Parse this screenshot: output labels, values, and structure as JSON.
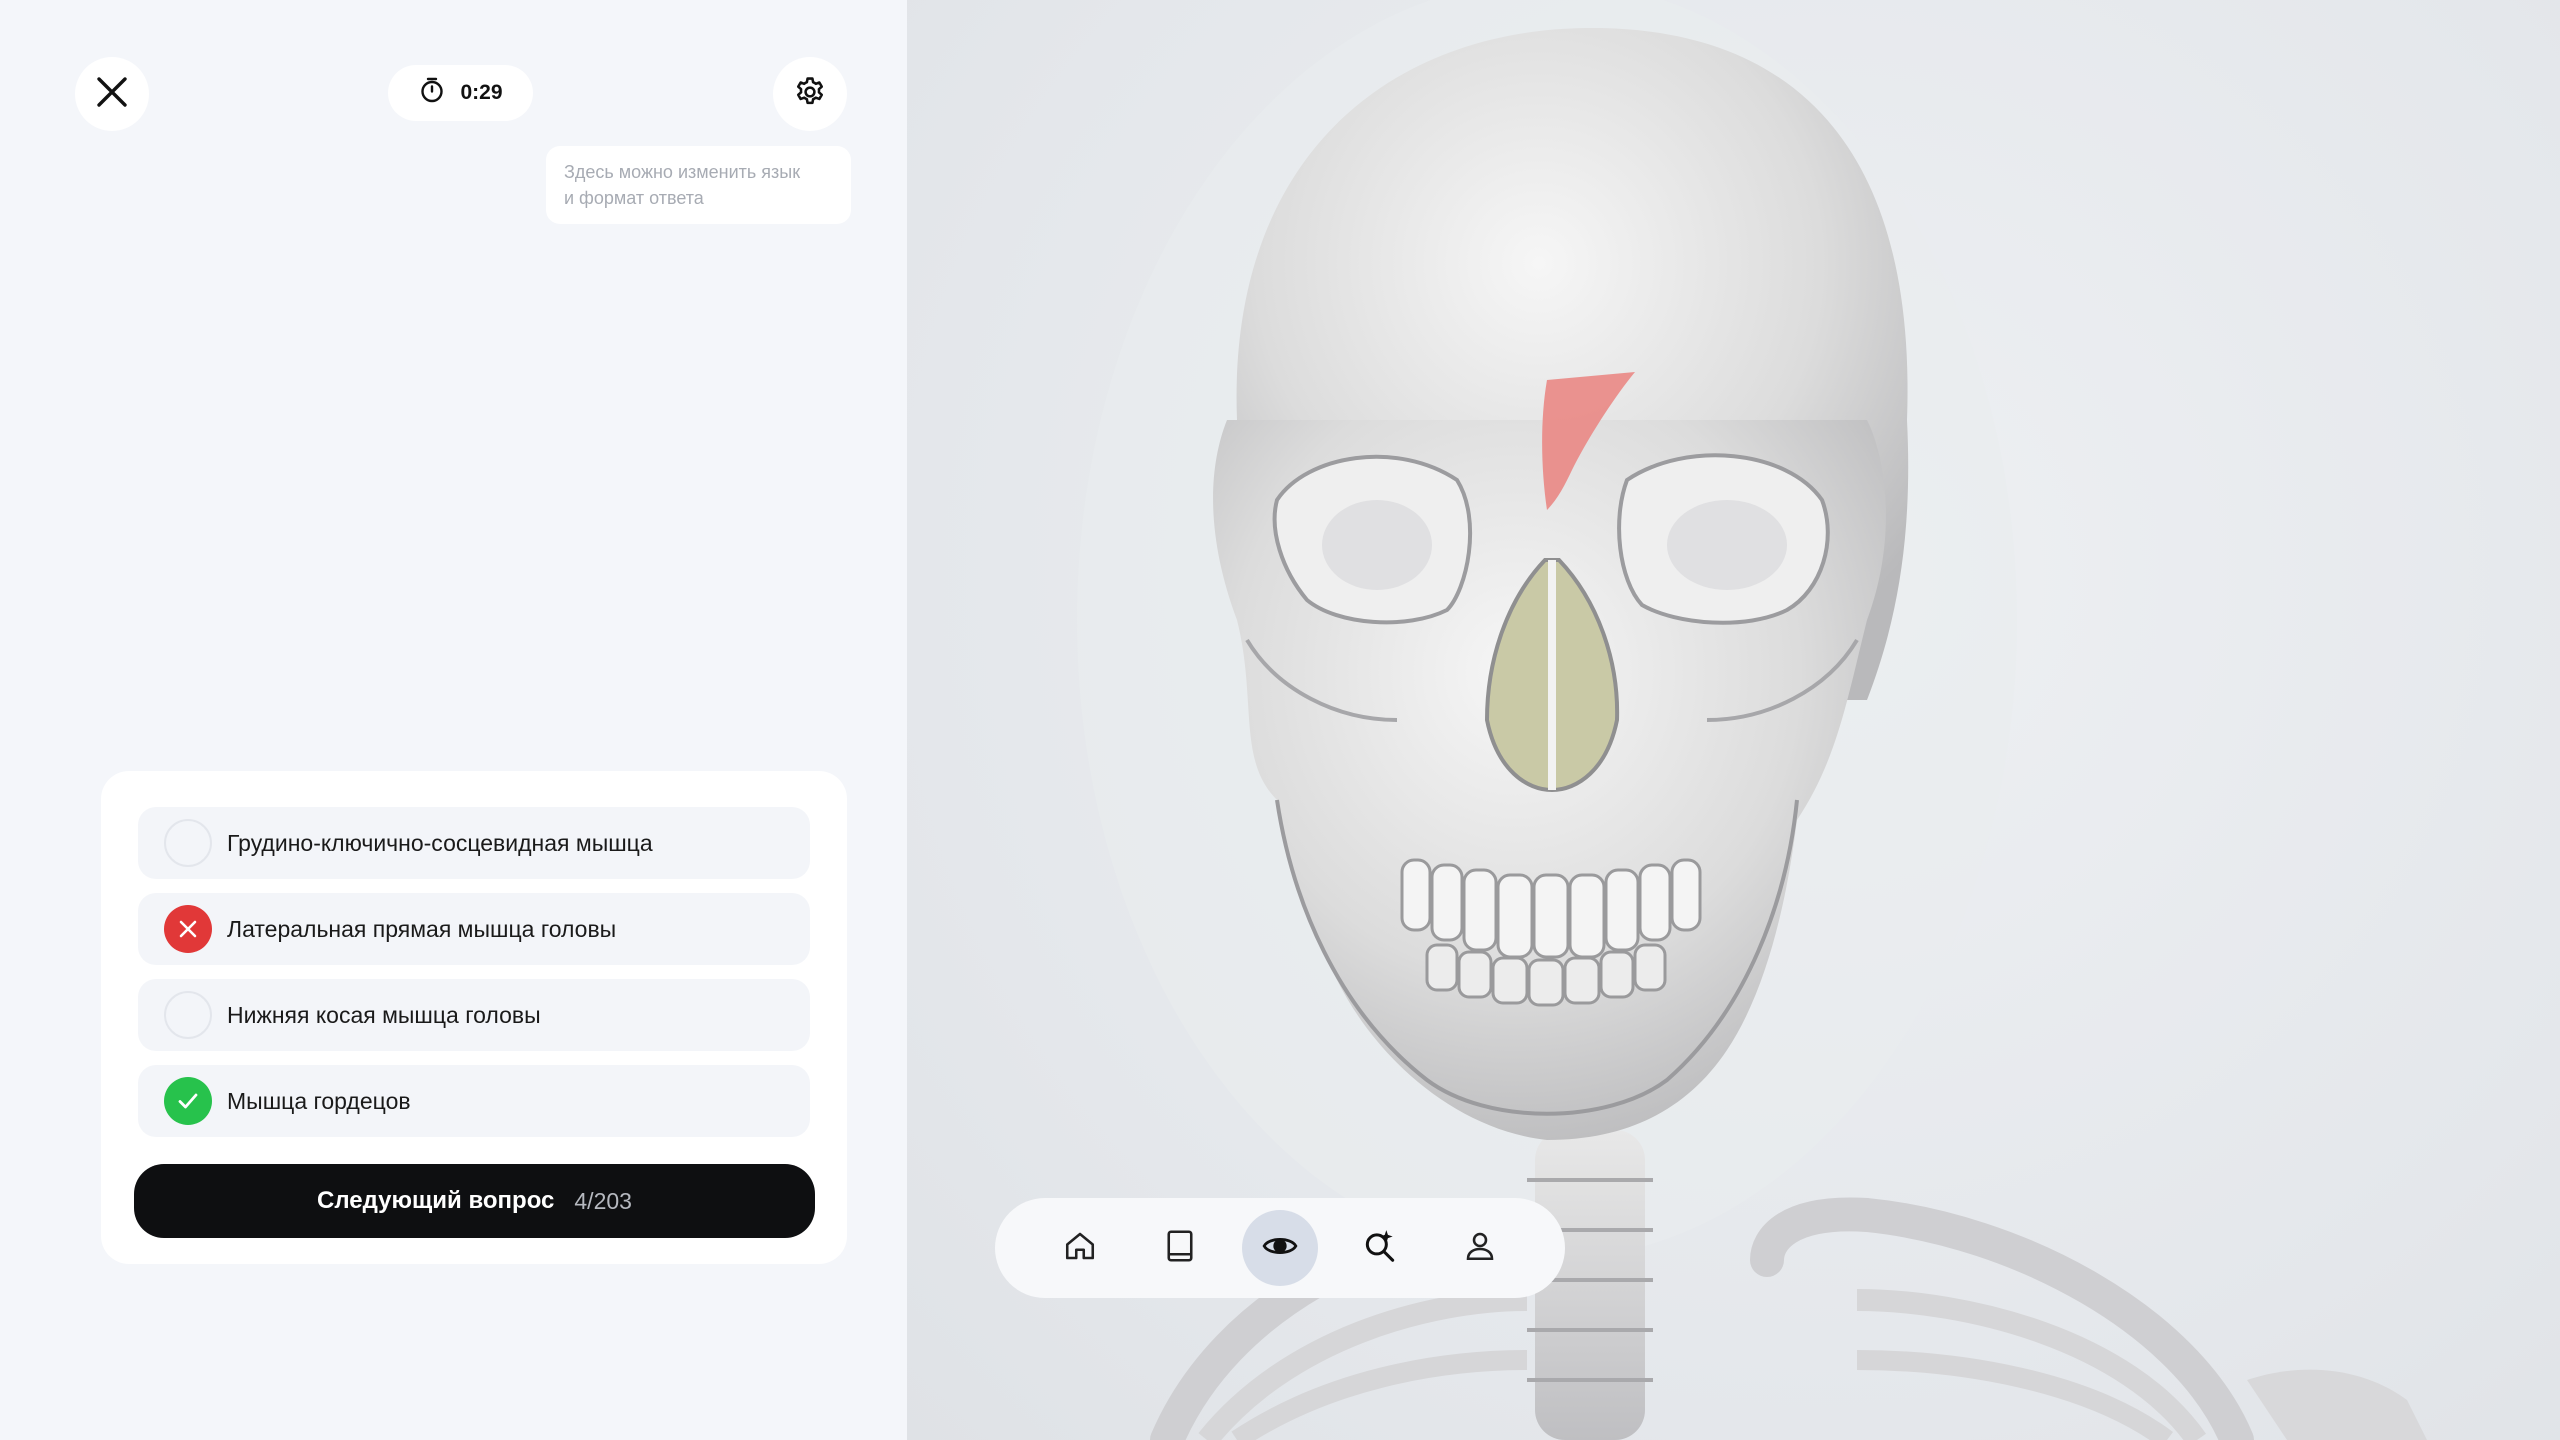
{
  "timer": {
    "value": "0:29"
  },
  "hint": {
    "line1": "Здесь можно изменить язык",
    "line2": "и формат ответа"
  },
  "answers": [
    {
      "label": "Грудино-ключично-сосцевидная мышца",
      "state": "unselected"
    },
    {
      "label": "Латеральная прямая мышца головы",
      "state": "wrong"
    },
    {
      "label": "Нижняя косая мышца головы",
      "state": "unselected"
    },
    {
      "label": "Мышца гордецов",
      "state": "correct"
    }
  ],
  "next_button": {
    "label": "Следующий вопрос",
    "counter": "4/203"
  },
  "dock": {
    "items": [
      "home-icon",
      "book-icon",
      "eye-icon",
      "search-sparkle-icon",
      "profile-icon"
    ],
    "active": "eye-icon"
  },
  "colors": {
    "wrong": "#e13838",
    "correct": "#27c24c",
    "highlight_muscle": "#e98a87",
    "button_dark": "#0e0f11"
  }
}
